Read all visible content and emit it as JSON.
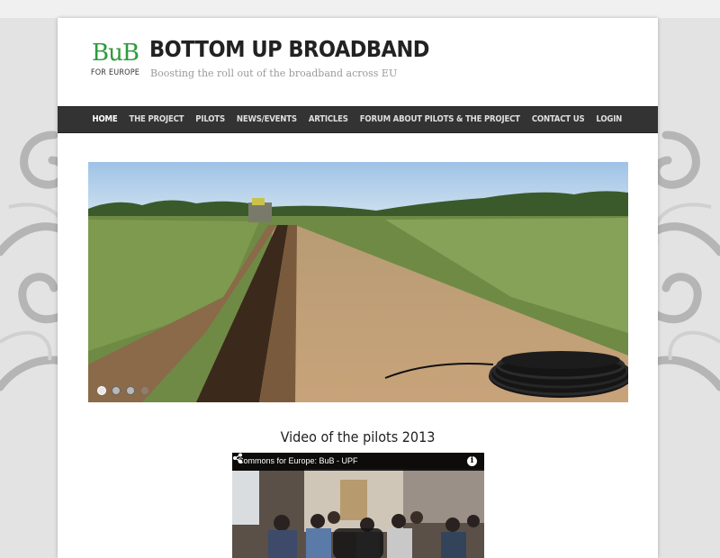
{
  "site": {
    "logo_text": "BuB",
    "logo_subtext": "FOR EUROPE",
    "title": "BOTTOM UP BROADBAND",
    "tagline": "Boosting the roll out of the broadband across EU"
  },
  "nav": {
    "items": [
      {
        "label": "HOME",
        "active": true
      },
      {
        "label": "THE PROJECT",
        "active": false
      },
      {
        "label": "PILOTS",
        "active": false
      },
      {
        "label": "NEWS/EVENTS",
        "active": false
      },
      {
        "label": "ARTICLES",
        "active": false
      },
      {
        "label": "FORUM ABOUT PILOTS & THE PROJECT",
        "active": false
      },
      {
        "label": "CONTACT US",
        "active": false
      },
      {
        "label": "LOGIN",
        "active": false
      }
    ]
  },
  "slider": {
    "image": "trench-in-field-with-cable-coil",
    "dots": 4,
    "active_dot": 0
  },
  "video_section": {
    "heading": "Video of the pilots 2013",
    "video_title": "Commons for Europe: BuB - UPF",
    "info_glyph": "i"
  },
  "colors": {
    "nav_bg": "#333333",
    "logo_green": "#2e9b3d",
    "page_bg": "#e3e3e3"
  }
}
